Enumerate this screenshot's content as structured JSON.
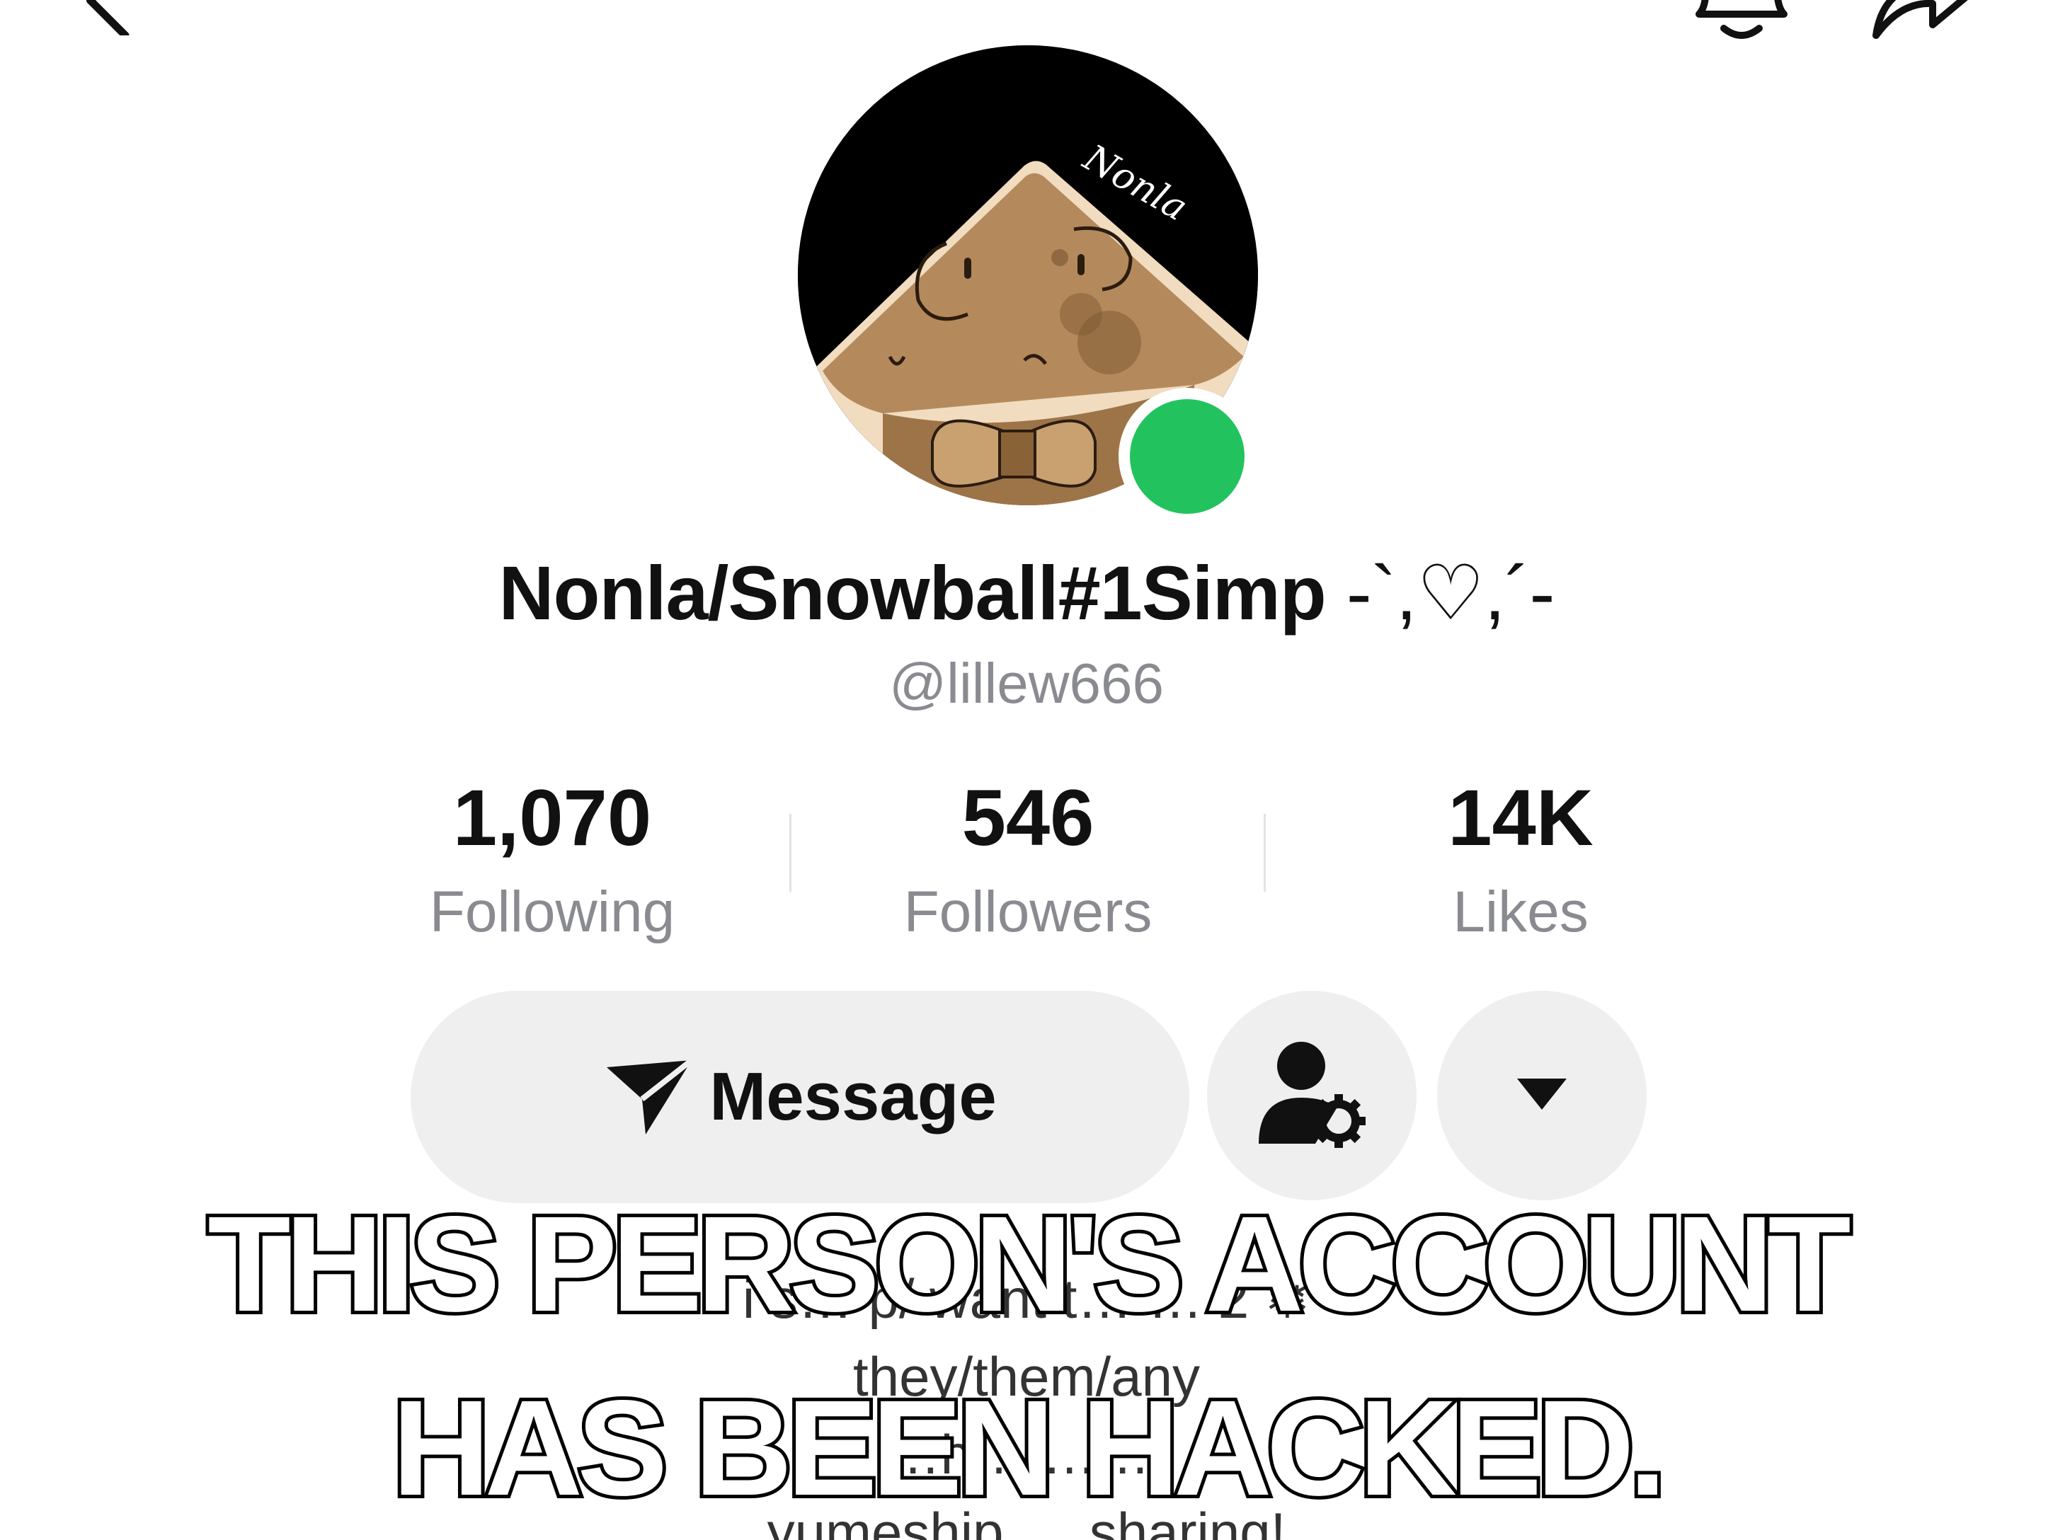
{
  "profile": {
    "display_name": "Nonla/Snowball#1Simp",
    "display_name_decoration": " -`,♡,´-",
    "handle": "@lillew666",
    "avatar_signature": "Nonla",
    "online_status_color": "#22c35e"
  },
  "stats": [
    {
      "value": "1,070",
      "label": "Following"
    },
    {
      "value": "546",
      "label": "Followers"
    },
    {
      "value": "14K",
      "label": "Likes"
    }
  ],
  "actions": {
    "message_label": "Message",
    "follow_settings_icon": "person-gear-icon",
    "more_icon": "caret-down-icon"
  },
  "bio": {
    "line1": "i s… p/ want t… … 2 ❄",
    "line2": "they/them/any",
    "line3": "…h… … …",
    "line4": "yumeship … sharing!"
  },
  "caption": {
    "line1": "THIS PERSON'S ACCOUNT",
    "line2": "HAS BEEN HACKED."
  },
  "colors": {
    "button_bg": "#efefef",
    "muted_text": "#8a8b91",
    "caption_fill": "#ffffff",
    "caption_stroke": "#000000"
  }
}
